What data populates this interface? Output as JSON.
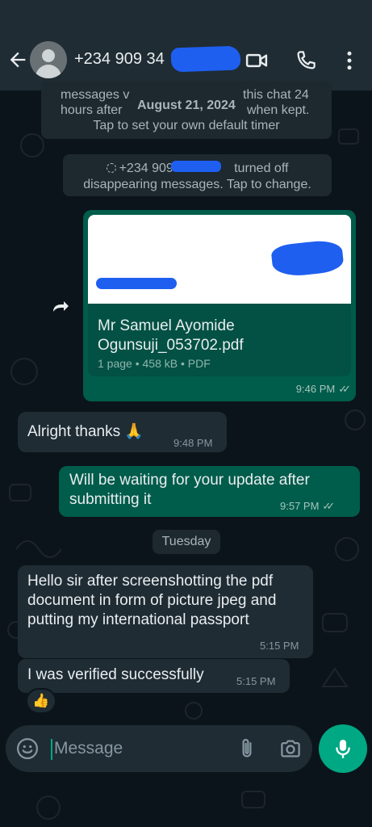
{
  "header": {
    "contact_name": "+234 909 34",
    "icons": [
      "back-arrow-icon",
      "avatar",
      "video-call-icon",
      "voice-call-icon",
      "more-options-icon"
    ]
  },
  "system_messages": {
    "disappearing_info": {
      "line1_left": "messages v",
      "line1_right": "this chat 24",
      "line2_left": "hours after",
      "line2_right": "when kept.",
      "line3": "Tap to set your own default timer"
    },
    "date_chip": "August 21, 2024",
    "turned_off": {
      "line1_prefix": "+234 909 3",
      "line1_suffix": "turned off",
      "line2": "disappearing messages. Tap to change."
    }
  },
  "document_message": {
    "file_name": "Mr Samuel Ayomide Ogunsuji_053702.pdf",
    "meta": "1 page • 458 kB • PDF",
    "time": "9:46 PM",
    "status": "read"
  },
  "messages": [
    {
      "direction": "incoming",
      "text": "Alright thanks 🙏",
      "time": "9:48 PM"
    },
    {
      "direction": "outgoing",
      "text": "Will be waiting for your update after submitting it",
      "time": "9:57 PM",
      "status": "read"
    }
  ],
  "day_chip": "Tuesday",
  "messages_later": [
    {
      "direction": "incoming",
      "text": "Hello sir after screenshotting the pdf document in form of picture jpeg and putting my international passport",
      "time": "5:15 PM"
    },
    {
      "direction": "incoming",
      "text": "I was verified successfully",
      "time": "5:15 PM",
      "reaction": "👍"
    }
  ],
  "composer": {
    "placeholder": "Message"
  },
  "colors": {
    "background": "#0b141a",
    "header": "#1f2c34",
    "incoming_bubble": "#1f2c34",
    "outgoing_bubble": "#005c4b",
    "accent": "#00a884",
    "redaction": "#1e5ff0"
  }
}
